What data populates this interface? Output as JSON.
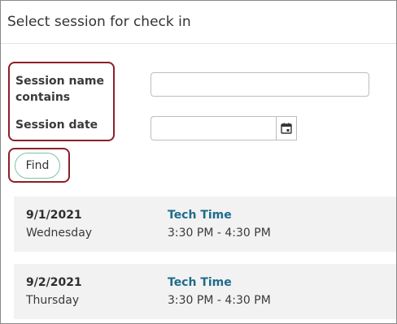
{
  "header": {
    "title": "Select session for check in"
  },
  "form": {
    "session_name_label": "Session name contains",
    "session_name_value": "",
    "session_date_label": "Session date",
    "session_date_value": "",
    "find_label": "Find"
  },
  "sessions": [
    {
      "date": "9/1/2021",
      "weekday": "Wednesday",
      "name": "Tech Time",
      "time": "3:30 PM - 4:30 PM"
    },
    {
      "date": "9/2/2021",
      "weekday": "Thursday",
      "name": "Tech Time",
      "time": "3:30 PM - 4:30 PM"
    }
  ],
  "icons": {
    "calendar": "calendar-icon"
  },
  "colors": {
    "highlight": "#8c1f2a",
    "find_border": "#7cc6a4",
    "session_name": "#1f6b8a",
    "card_bg": "#f2f2f2"
  }
}
